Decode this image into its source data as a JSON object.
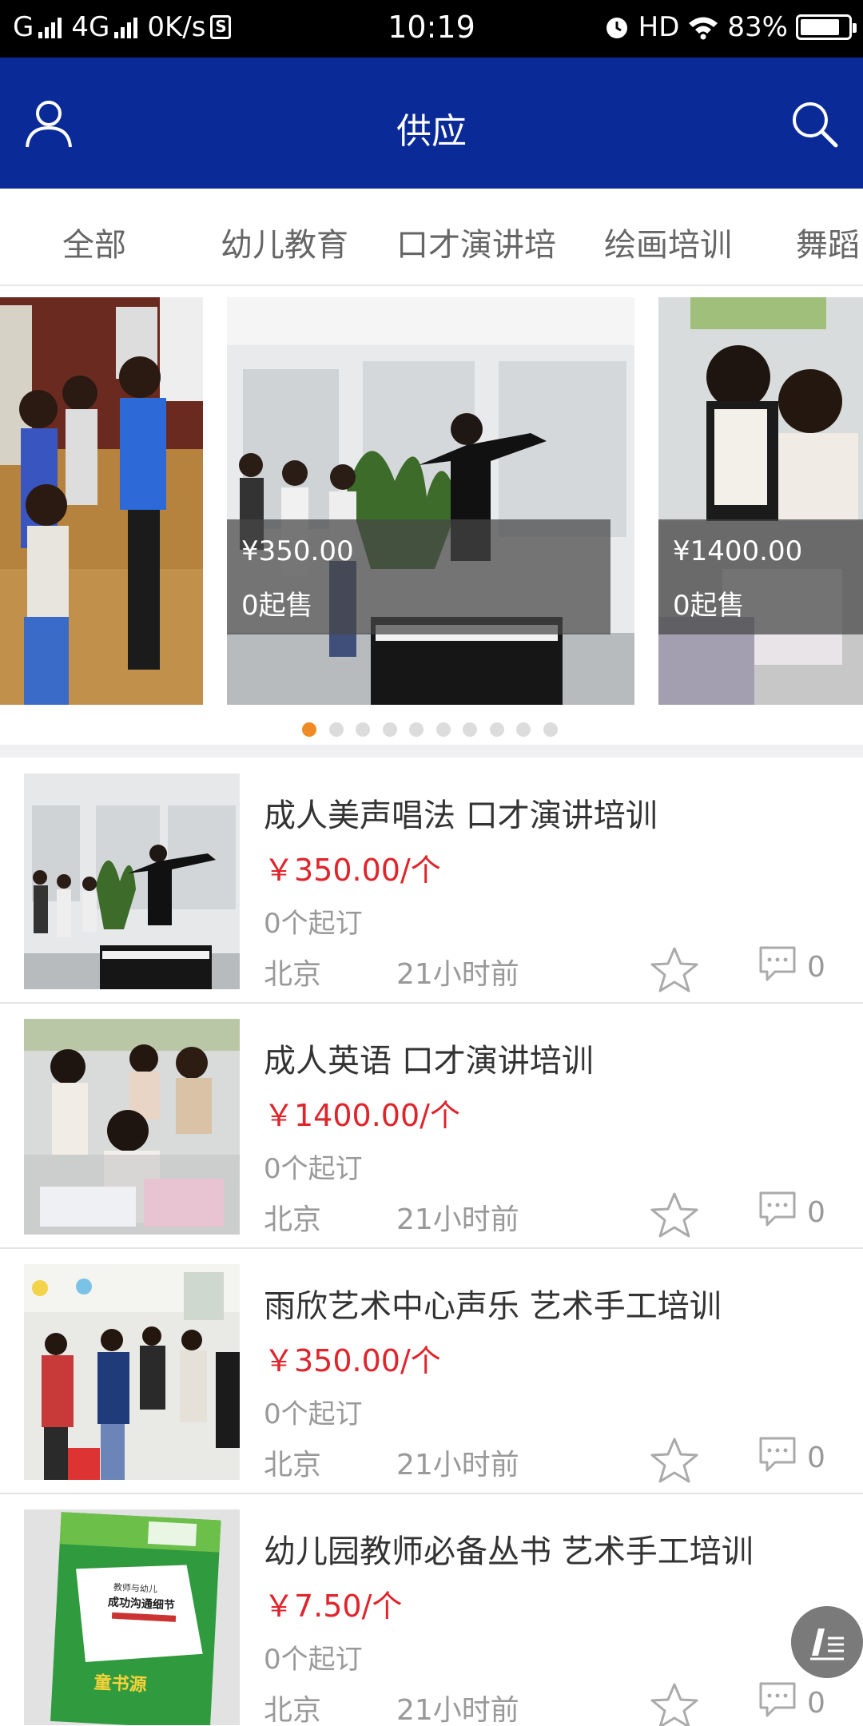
{
  "status_bar": {
    "network1": "G",
    "network2": "4G",
    "speed": "0K/s",
    "sim_icon_text": "S",
    "time": "10:19",
    "hd": "HD",
    "battery": "83%",
    "battery_level": 0.83
  },
  "header": {
    "title": "供应",
    "left_icon": "user-icon",
    "right_icon": "search-icon",
    "background": "#0a2a97"
  },
  "tabs": [
    "全部",
    "幼儿教育",
    "口才演讲培",
    "绘画培训",
    "舞蹈"
  ],
  "carousel": {
    "slides": [
      {
        "price": "",
        "min_sale": ""
      },
      {
        "price": "¥350.00",
        "min_sale": "0起售"
      },
      {
        "price": "¥1400.00",
        "min_sale": "0起售"
      }
    ],
    "dot_count": 10,
    "active_dot": 0,
    "active_color": "#f08a24"
  },
  "items": [
    {
      "name": "成人美声唱法 口才演讲培训",
      "price": "￥350.00/个",
      "moq": "0个起订",
      "city": "北京",
      "time": "21小时前",
      "comments": "0"
    },
    {
      "name": "成人英语 口才演讲培训",
      "price": "￥1400.00/个",
      "moq": "0个起订",
      "city": "北京",
      "time": "21小时前",
      "comments": "0"
    },
    {
      "name": "雨欣艺术中心声乐 艺术手工培训",
      "price": "￥350.00/个",
      "moq": "0个起订",
      "city": "北京",
      "time": "21小时前",
      "comments": "0"
    },
    {
      "name": "幼儿园教师必备丛书 艺术手工培训",
      "price": "￥7.50/个",
      "moq": "0个起订",
      "city": "北京",
      "time": "21小时前",
      "comments": "0"
    }
  ],
  "book_cover": {
    "line1": "教师与幼儿",
    "line2": "成功沟通细节",
    "brand": "童书源"
  },
  "colors": {
    "price": "#e0242b",
    "muted": "#999999"
  }
}
